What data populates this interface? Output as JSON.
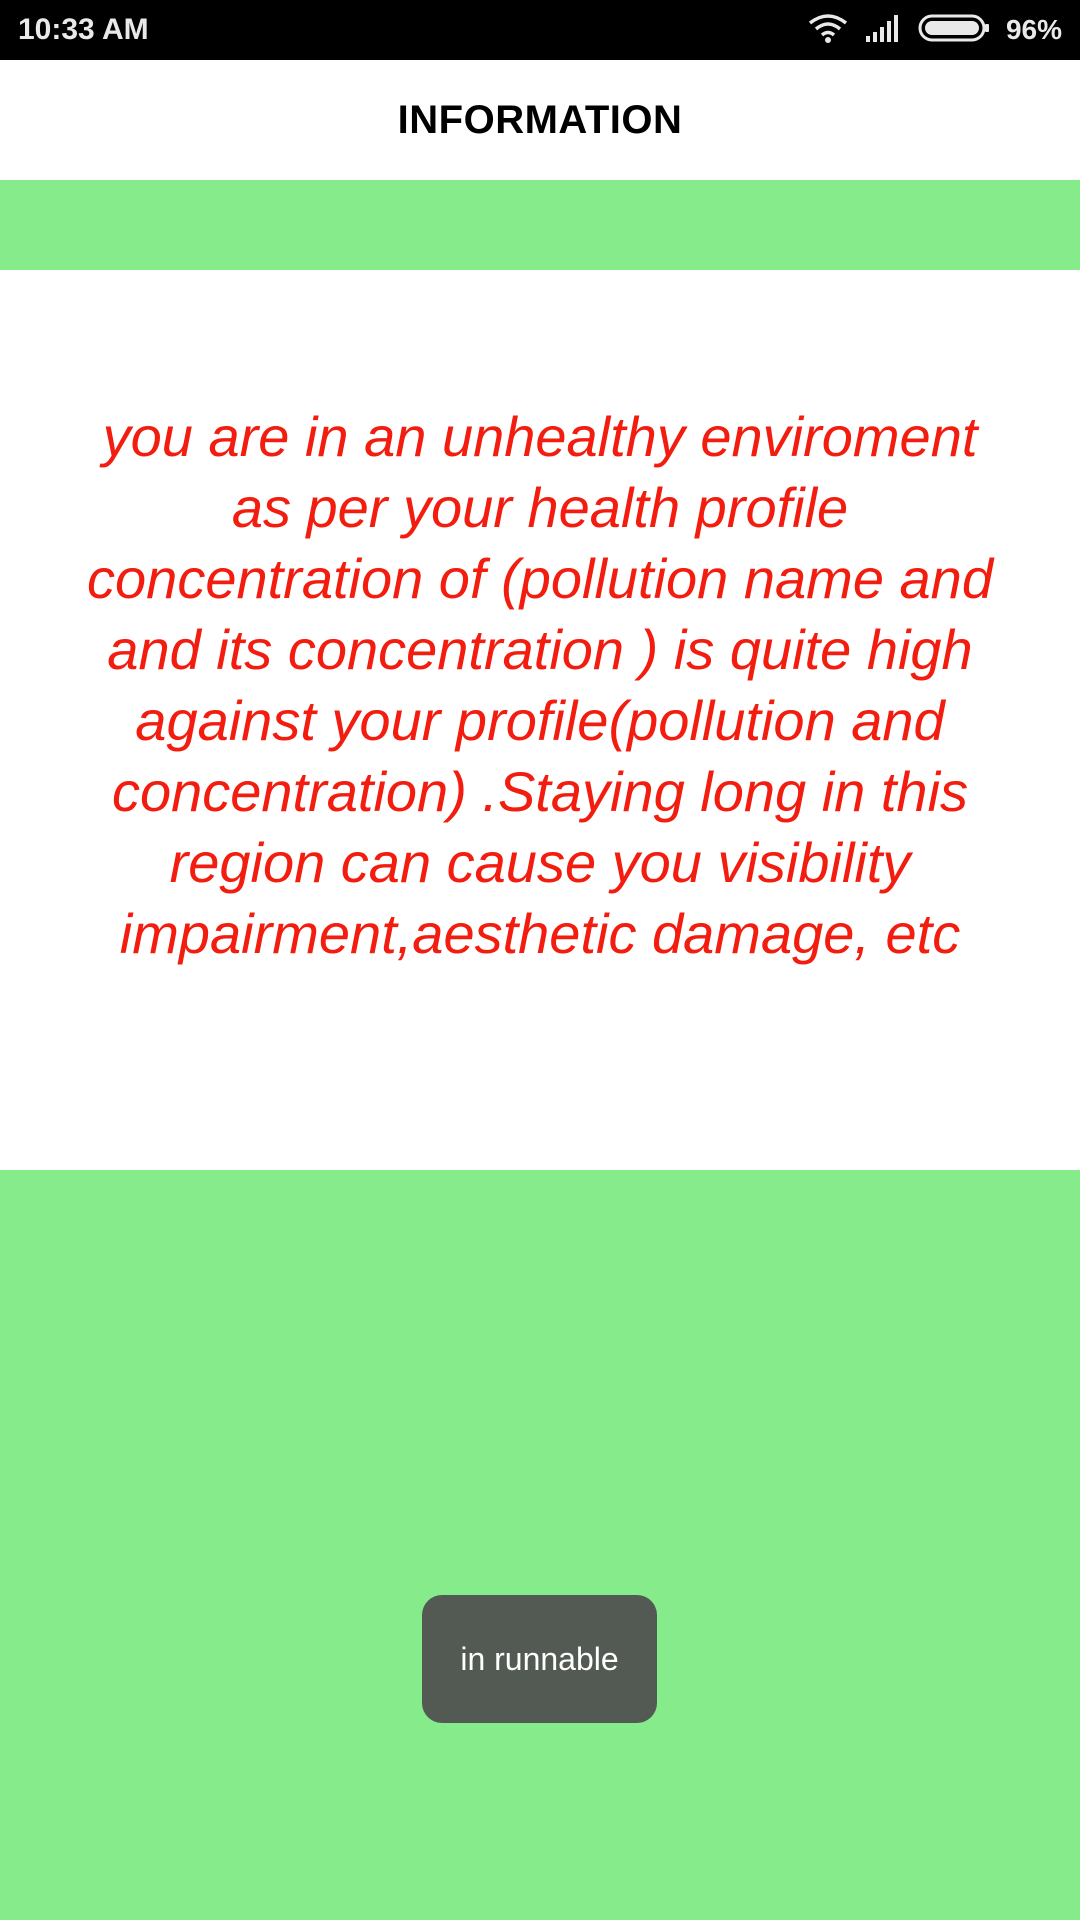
{
  "status_bar": {
    "time": "10:33 AM",
    "battery_percent": "96%",
    "icons": [
      "wifi-icon",
      "signal-icon",
      "battery-icon"
    ]
  },
  "header": {
    "title": "INFORMATION"
  },
  "message": {
    "text": "you are in an unhealthy enviroment as per your health profile concentration of (pollution name and and its concentration ) is quite high against your profile(pollution and concentration) .Staying long in this region can cause you visibility impairment,aesthetic damage, etc"
  },
  "toast": {
    "text": "in runnable"
  },
  "colors": {
    "accent_green": "#86eb8a",
    "message_red": "#f21c0f",
    "toast_bg": "#535a54"
  }
}
